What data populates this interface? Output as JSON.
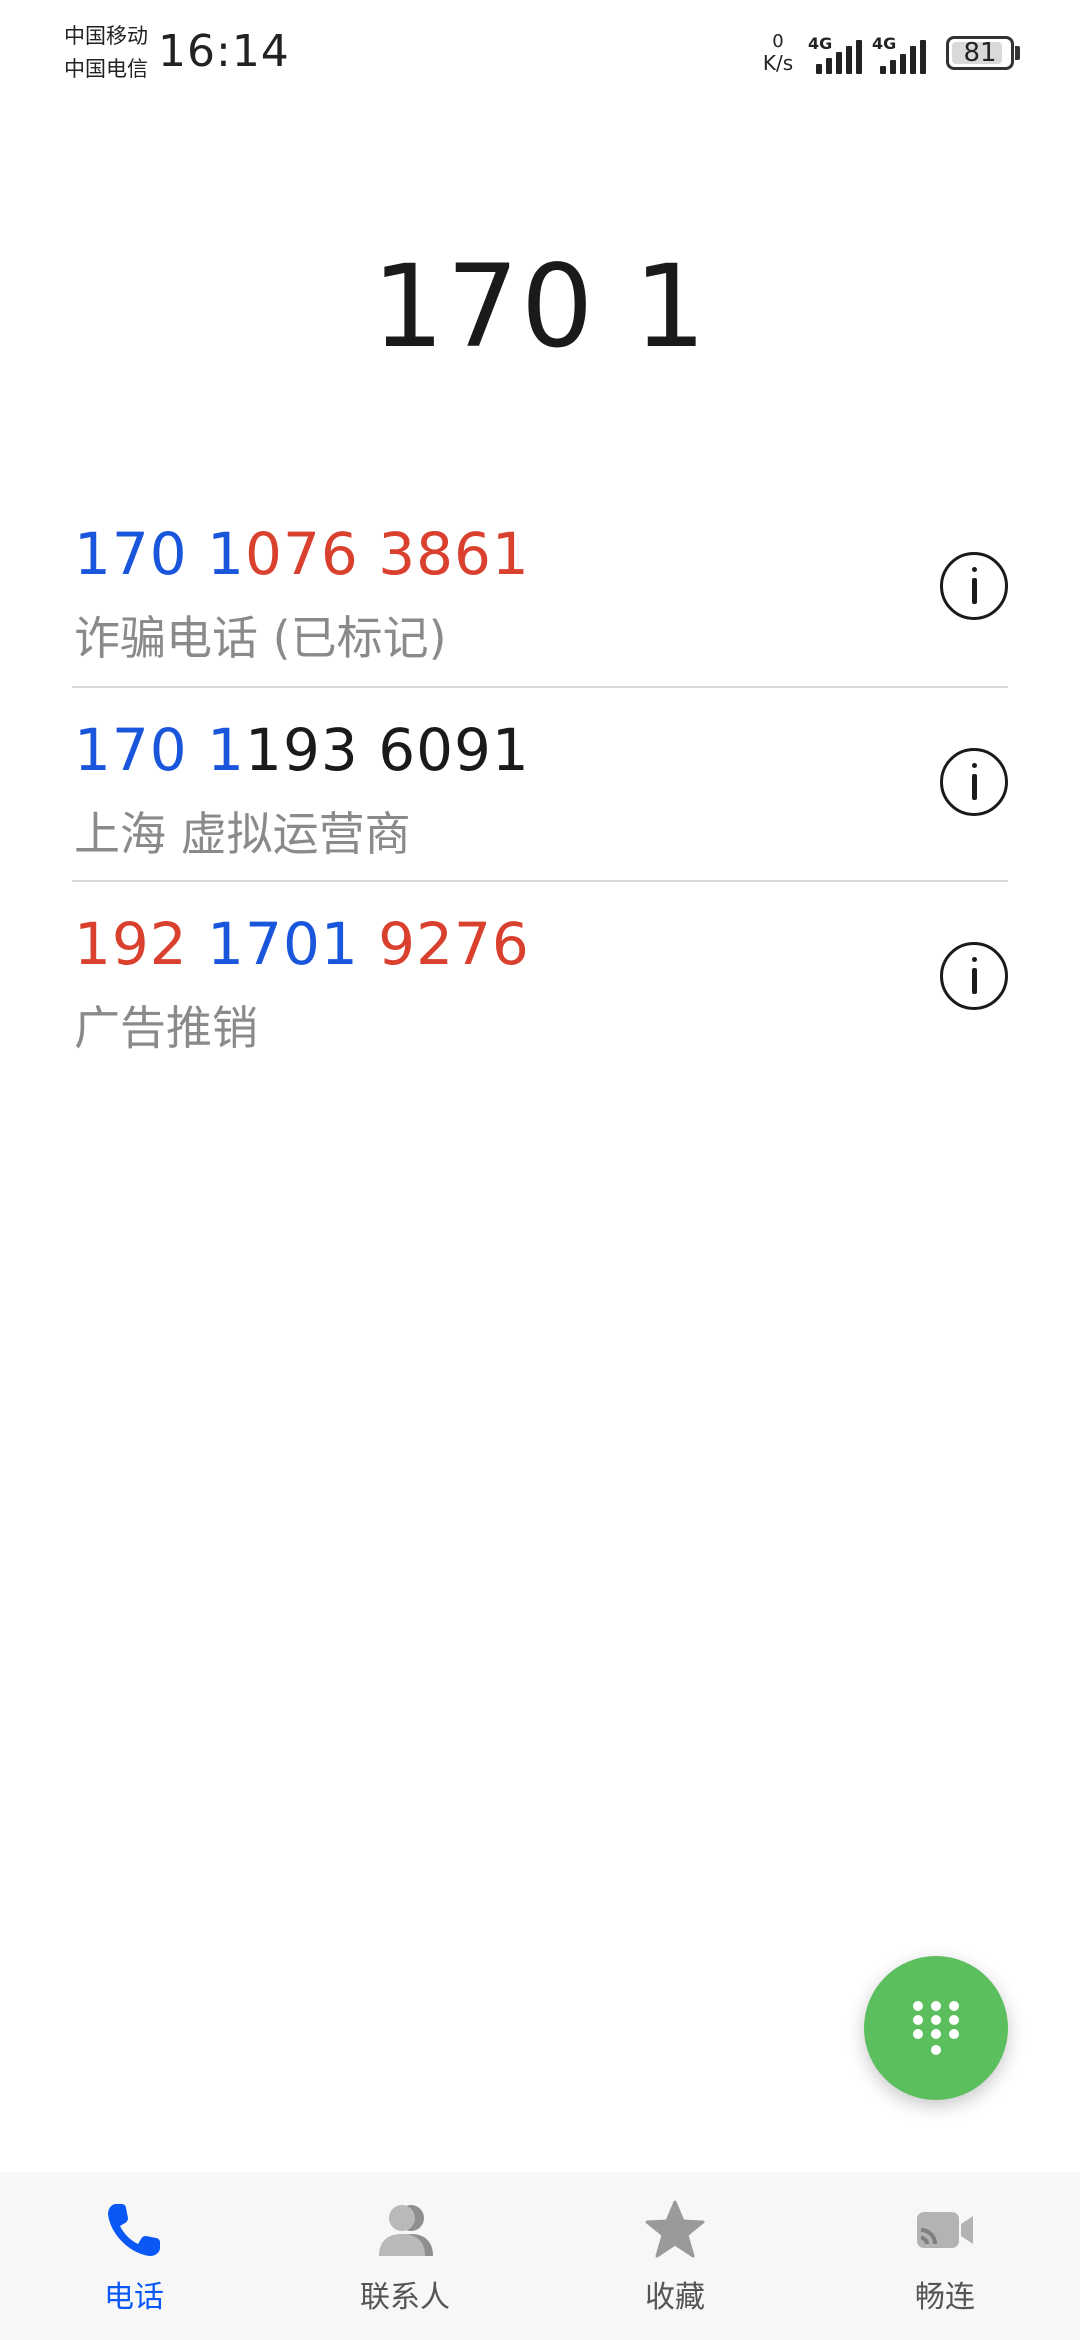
{
  "status_bar": {
    "carrier_1": "中国移动",
    "carrier_2": "中国电信",
    "time": "16:14",
    "net_speed_value": "0",
    "net_speed_unit": "K/s",
    "signal_1_type": "4G",
    "signal_2_type": "4G",
    "battery_level": "81"
  },
  "dialer": {
    "input": "170 1"
  },
  "colors": {
    "match_blue": "#1a56db",
    "spam_red": "#d9402e",
    "normal_text": "#1a1a1a",
    "label_gray": "#8a8a8a",
    "active_tab": "#0a59f7",
    "fab_green": "#5cbf5e"
  },
  "results": [
    {
      "segments": [
        {
          "text": "170 1",
          "color": "blue"
        },
        {
          "text": "076 3861",
          "color": "red"
        }
      ],
      "label": "诈骗电话 (已标记)",
      "action_icon": "info-icon"
    },
    {
      "segments": [
        {
          "text": "170 1",
          "color": "blue"
        },
        {
          "text": "193 6091",
          "color": "black"
        }
      ],
      "label": "上海 虚拟运营商",
      "action_icon": "info-icon"
    },
    {
      "segments": [
        {
          "text": "192 ",
          "color": "red"
        },
        {
          "text": "1701",
          "color": "blue"
        },
        {
          "text": " 9276",
          "color": "red"
        }
      ],
      "label": "广告推销",
      "action_icon": "info-icon"
    }
  ],
  "fab": {
    "icon": "dialpad-icon"
  },
  "bottom_nav": {
    "items": [
      {
        "label": "电话",
        "icon": "phone-icon",
        "active": true
      },
      {
        "label": "联系人",
        "icon": "contacts-icon",
        "active": false
      },
      {
        "label": "收藏",
        "icon": "star-icon",
        "active": false
      },
      {
        "label": "畅连",
        "icon": "meetime-icon",
        "active": false
      }
    ]
  }
}
